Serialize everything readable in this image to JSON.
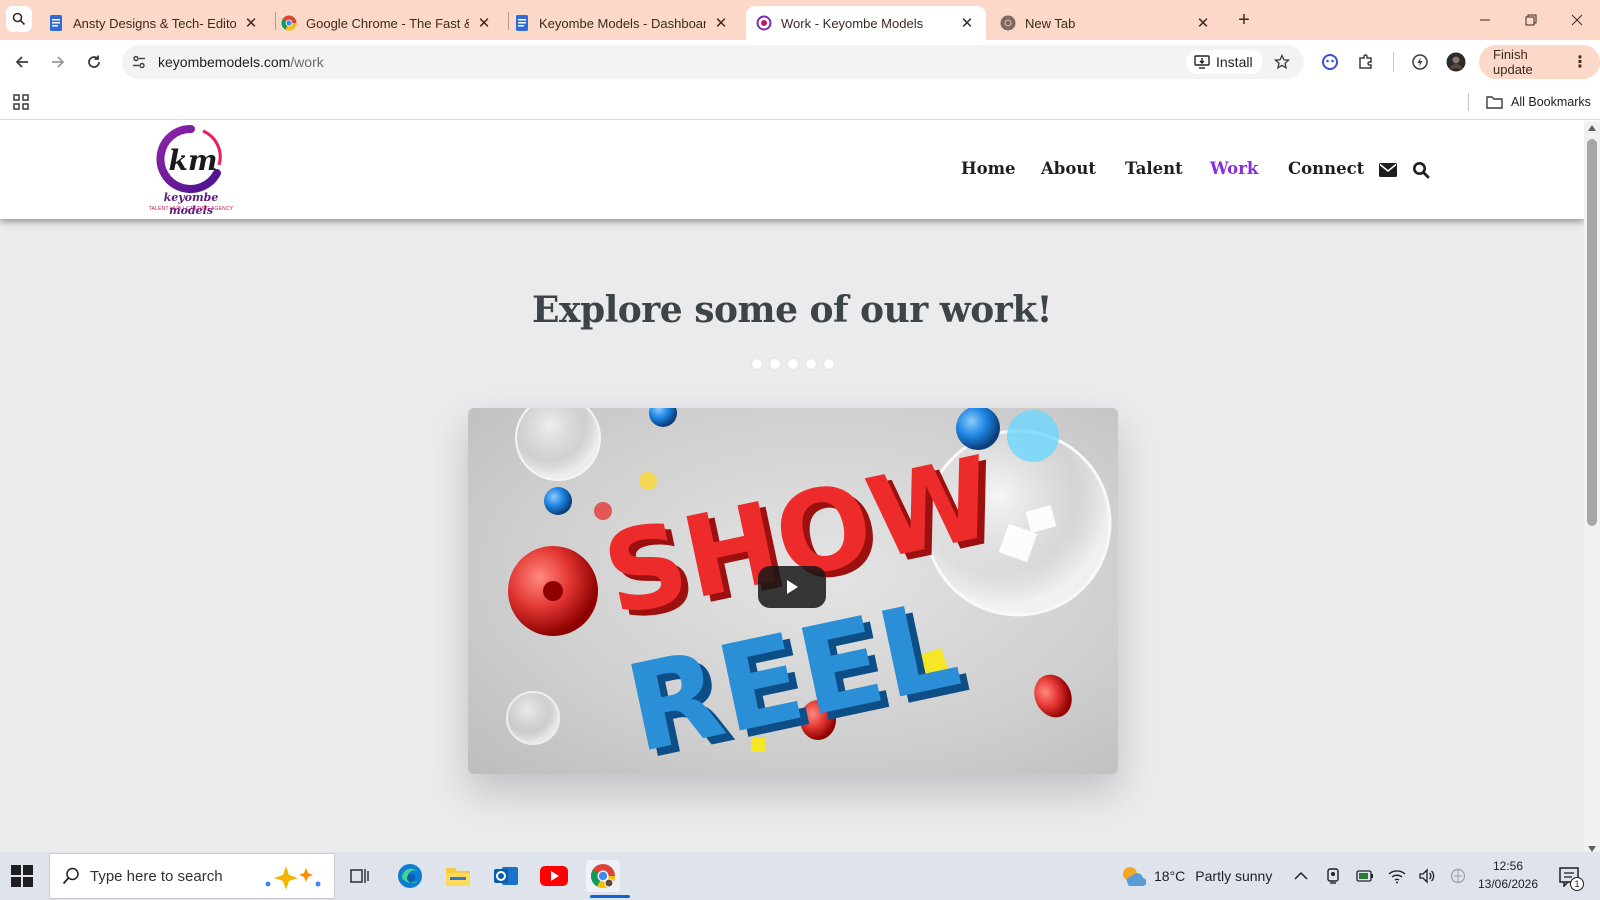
{
  "browser": {
    "tabs": [
      {
        "title": "Ansty Designs & Tech- Editor -",
        "favicon": "doc-icon",
        "active": false
      },
      {
        "title": "Google Chrome - The Fast & Se",
        "favicon": "chrome-icon",
        "active": false
      },
      {
        "title": "Keyombe Models - Dashboard",
        "favicon": "doc-icon",
        "active": false
      },
      {
        "title": "Work - Keyombe Models",
        "favicon": "site-logo-icon",
        "active": true
      },
      {
        "title": "New Tab",
        "favicon": "chrome-icon",
        "active": false
      }
    ],
    "url_domain": "keyombemodels.com",
    "url_path": "/work",
    "install_label": "Install",
    "finish_update_label": "Finish update",
    "all_bookmarks_label": "All Bookmarks",
    "accent_color": "#fbd8c7"
  },
  "site": {
    "logo_text": "keyombe models",
    "logo_subtext": "TALENT HUB | CASTING AGENCY",
    "logo_letters": "km",
    "nav": [
      {
        "label": "Home",
        "active": false
      },
      {
        "label": "About",
        "active": false
      },
      {
        "label": "Talent",
        "active": false
      },
      {
        "label": "Work",
        "active": true
      },
      {
        "label": "Connect",
        "active": false
      }
    ],
    "nav_icons": [
      "envelope-icon",
      "search-icon"
    ],
    "active_color": "#8a2be2",
    "section_title": "Explore some of our work!",
    "carousel_dots": 5,
    "video": {
      "line1": "SHOW",
      "line2": "REEL",
      "play_icon": "play-icon"
    }
  },
  "taskbar": {
    "search_placeholder": "Type here to search",
    "weather_temp": "18°C",
    "weather_condition": "Partly sunny",
    "time": "12:56",
    "date": "13/06/2026",
    "notification_count": "1"
  }
}
